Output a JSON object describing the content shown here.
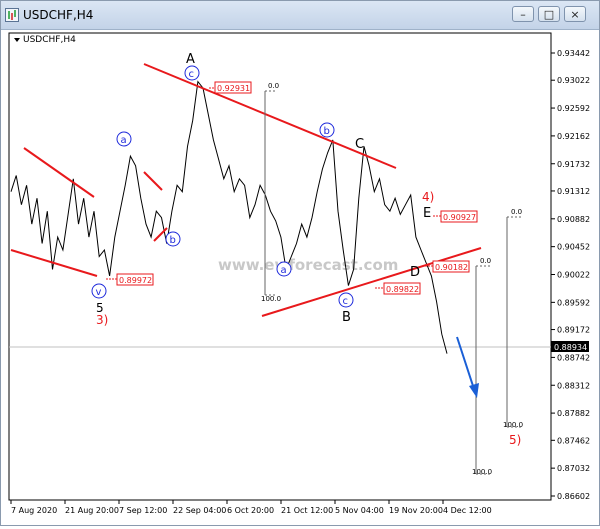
{
  "window": {
    "title": "USDCHF,H4",
    "minimize_label": "–",
    "maximize_label": "□",
    "close_label": "×"
  },
  "chart": {
    "symbol_label": "USDCHF,H4",
    "watermark": "www.ewforecast.com",
    "current_price": "0.88934",
    "colors": {
      "trendline": "#e8191c",
      "wave": "#1e2adb",
      "price": "#000000",
      "arrow": "#1a5fd6",
      "level": "#e8191c"
    }
  },
  "chart_data": {
    "type": "line",
    "title": "",
    "instrument": "USDCHF",
    "timeframe": "H4",
    "xlabel": "",
    "ylabel": "",
    "ylim": [
      0.86602,
      0.93442
    ],
    "y_ticks": [
      "0.93442",
      "0.93022",
      "0.92592",
      "0.92162",
      "0.91732",
      "0.91312",
      "0.90882",
      "0.90452",
      "0.90022",
      "0.89592",
      "0.89172",
      "0.88742",
      "0.88312",
      "0.87882",
      "0.87462",
      "0.87032",
      "0.86602"
    ],
    "x_ticks": [
      "7 Aug 2020",
      "21 Aug 20:00",
      "7 Sep 12:00",
      "22 Sep 04:00",
      "6 Oct 20:00",
      "21 Oct 12:00",
      "5 Nov 04:00",
      "19 Nov 20:00",
      "4 Dec 12:00"
    ],
    "series": [
      {
        "values": [
          0.913,
          0.9155,
          0.911,
          0.914,
          0.908,
          0.912,
          0.905,
          0.91,
          0.901,
          0.906,
          0.904,
          0.9095,
          0.915,
          0.908,
          0.912,
          0.906,
          0.91,
          0.903,
          0.904,
          0.9,
          0.906,
          0.91,
          0.914,
          0.9185,
          0.917,
          0.912,
          0.908,
          0.906,
          0.91,
          0.909,
          0.905,
          0.91,
          0.914,
          0.913,
          0.92,
          0.924,
          0.93,
          0.929,
          0.925,
          0.921,
          0.918,
          0.915,
          0.917,
          0.913,
          0.915,
          0.914,
          0.909,
          0.911,
          0.914,
          0.9125,
          0.91,
          0.9085,
          0.906,
          0.901,
          0.903,
          0.905,
          0.908,
          0.906,
          0.909,
          0.913,
          0.9165,
          0.919,
          0.921,
          0.91,
          0.904,
          0.8985,
          0.901,
          0.912,
          0.92,
          0.917,
          0.913,
          0.915,
          0.911,
          0.91,
          0.912,
          0.9095,
          0.911,
          0.9125,
          0.906,
          0.904,
          0.902,
          0.9,
          0.896,
          0.891,
          0.888
        ]
      }
    ],
    "wave_labels": [
      {
        "text": "A",
        "style": "black"
      },
      {
        "text": "c",
        "style": "circled"
      },
      {
        "text": "a",
        "style": "circled"
      },
      {
        "text": "b",
        "style": "circled"
      },
      {
        "text": "b",
        "style": "circled"
      },
      {
        "text": "C",
        "style": "black"
      },
      {
        "text": "a",
        "style": "circled"
      },
      {
        "text": "c",
        "style": "circled"
      },
      {
        "text": "B",
        "style": "black"
      },
      {
        "text": "v",
        "style": "circled"
      },
      {
        "text": "5",
        "style": "black"
      },
      {
        "text": "3)",
        "style": "red"
      },
      {
        "text": "4)",
        "style": "red"
      },
      {
        "text": "E",
        "style": "black"
      },
      {
        "text": "D",
        "style": "black"
      },
      {
        "text": "5)",
        "style": "red"
      }
    ],
    "level_labels": [
      "0.92931",
      "0.89972",
      "0.89822",
      "0.90927",
      "0.90182"
    ],
    "fib_labels": [
      "0.0",
      "100.0",
      "0.0",
      "100.0",
      "0.0",
      "100.0"
    ]
  }
}
